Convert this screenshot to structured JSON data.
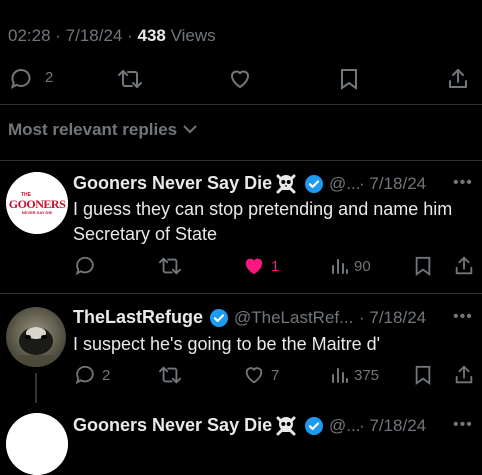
{
  "post": {
    "time": "02:28",
    "sep1": " · ",
    "date": "7/18/24",
    "sep2": " · ",
    "views_count": "438",
    "views_label": " Views",
    "reply_count": "2"
  },
  "replies_sort": {
    "label": "Most relevant replies"
  },
  "replies": [
    {
      "name": "Gooners Never Say Die",
      "handle": "@...",
      "date": "· 7/18/24",
      "text": "I guess they can stop pretending and name him Secretary of State",
      "reply_count": "",
      "like_count": "1",
      "views": "90",
      "liked": true,
      "avatar_text": "GOONERS",
      "avatar_top": "THE",
      "avatar_sub": "NEVER SAY DIE"
    },
    {
      "name": "TheLastRefuge",
      "handle": "@TheLastRef...",
      "date": "· 7/18/24",
      "text": "I suspect he's going to be the Maitre d'",
      "reply_count": "2",
      "like_count": "7",
      "views": "375",
      "liked": false
    },
    {
      "name": "Gooners Never Say Die",
      "handle": "@...",
      "date": "· 7/18/24"
    }
  ],
  "colors": {
    "like_active": "#f91880",
    "verified": "#1d9bf0",
    "text_secondary": "#71767b"
  }
}
